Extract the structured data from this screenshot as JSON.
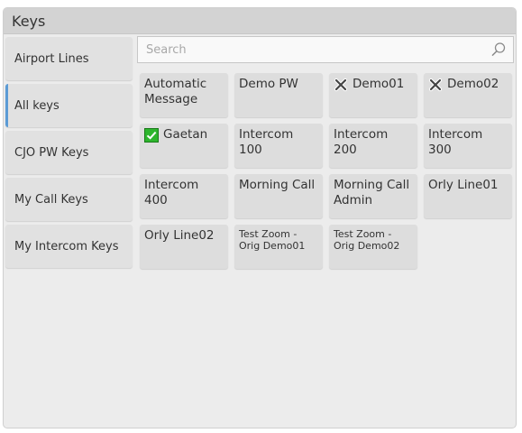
{
  "header": {
    "title": "Keys"
  },
  "sidebar": {
    "items": [
      {
        "label": "Airport Lines"
      },
      {
        "label": "All keys"
      },
      {
        "label": "CJO PW Keys"
      },
      {
        "label": "My Call Keys"
      },
      {
        "label": "My Intercom Keys"
      }
    ],
    "active_label": "All keys"
  },
  "search": {
    "placeholder": "Search",
    "value": ""
  },
  "keys": [
    {
      "label": "Automatic\nMessage",
      "status": ""
    },
    {
      "label": "Demo PW",
      "status": ""
    },
    {
      "label": "Demo01",
      "status": "cross-icon"
    },
    {
      "label": "Demo02",
      "status": "cross-icon"
    },
    {
      "label": "Gaetan",
      "status": "check-icon"
    },
    {
      "label": "Intercom 100",
      "status": ""
    },
    {
      "label": "Intercom 200",
      "status": ""
    },
    {
      "label": "Intercom 300",
      "status": ""
    },
    {
      "label": "Intercom 400",
      "status": ""
    },
    {
      "label": "Morning Call",
      "status": ""
    },
    {
      "label": "Morning Call\nAdmin",
      "status": ""
    },
    {
      "label": "Orly Line01",
      "status": ""
    },
    {
      "label": "Orly Line02",
      "status": ""
    },
    {
      "label": "Test Zoom -\nOrig Demo01",
      "status": "",
      "small": true
    },
    {
      "label": "Test Zoom -\nOrig Demo02",
      "status": "",
      "small": true
    }
  ],
  "colors": {
    "active_indicator": "#5b9bd5",
    "check_green": "#2db52d"
  }
}
